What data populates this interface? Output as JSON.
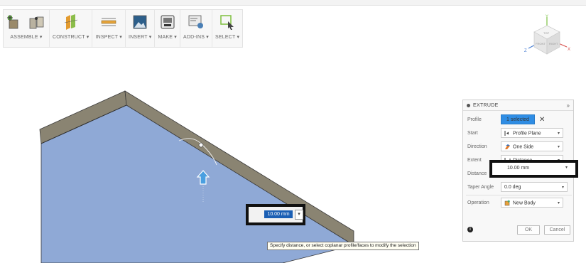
{
  "toolbar": {
    "groups": [
      {
        "name": "assemble",
        "label": "ASSEMBLE ▾"
      },
      {
        "name": "construct",
        "label": "CONSTRUCT ▾"
      },
      {
        "name": "inspect",
        "label": "INSPECT ▾"
      },
      {
        "name": "insert",
        "label": "INSERT ▾"
      },
      {
        "name": "make",
        "label": "MAKE ▾"
      },
      {
        "name": "addins",
        "label": "ADD-INS ▾"
      },
      {
        "name": "select",
        "label": "SELECT ▾"
      }
    ]
  },
  "viewcube": {
    "top": "TOP",
    "front": "FRONT",
    "right": "RIGHT",
    "axis_x": "X",
    "axis_y": "Y",
    "axis_z": "Z"
  },
  "inline_input": {
    "value": "10.00 mm",
    "dropdown": "▾"
  },
  "tooltip": "Specify distance, or select coplanar profile/faces to modify the selection",
  "extrude_panel": {
    "title": "EXTRUDE",
    "collapse": "»",
    "profile_label": "Profile",
    "profile_value": "1 selected",
    "clear_symbol": "✕",
    "start_label": "Start",
    "start_value": "Profile Plane",
    "direction_label": "Direction",
    "direction_value": "One Side",
    "extent_label": "Extent",
    "extent_value": "Distance",
    "distance_label": "Distance",
    "distance_value": "10.00 mm",
    "taper_label": "Taper Angle",
    "taper_value": "0.0 deg",
    "operation_label": "Operation",
    "operation_value": "New Body",
    "info": "i",
    "ok": "OK",
    "cancel": "Cancel"
  },
  "colors": {
    "face_blue": "#8fa9d6",
    "wall_gray": "#8a8472",
    "accent_blue": "#2f8de4",
    "arrow_blue": "#4a9fe0"
  }
}
